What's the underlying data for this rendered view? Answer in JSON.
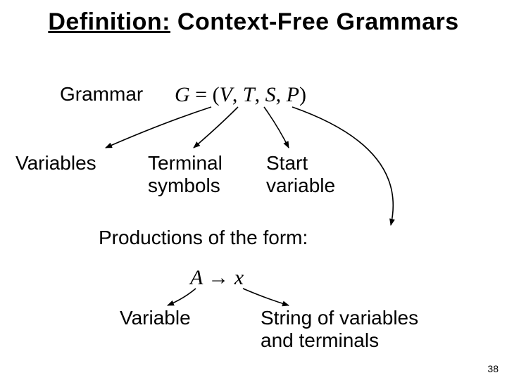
{
  "title": {
    "prefix": "Definition:",
    "rest": " Context-Free Grammars"
  },
  "labels": {
    "grammar": "Grammar",
    "variables": "Variables",
    "terminal_line1": "Terminal",
    "terminal_line2": "symbols",
    "start_line1": "Start",
    "start_line2": "variable",
    "productions": "Productions of the form:",
    "variable": "Variable",
    "string_line1": "String of variables",
    "string_line2": "and terminals"
  },
  "formulas": {
    "grammar_tuple": "G = (V, T, S, P)",
    "production": "A → x"
  },
  "page_number": "38"
}
